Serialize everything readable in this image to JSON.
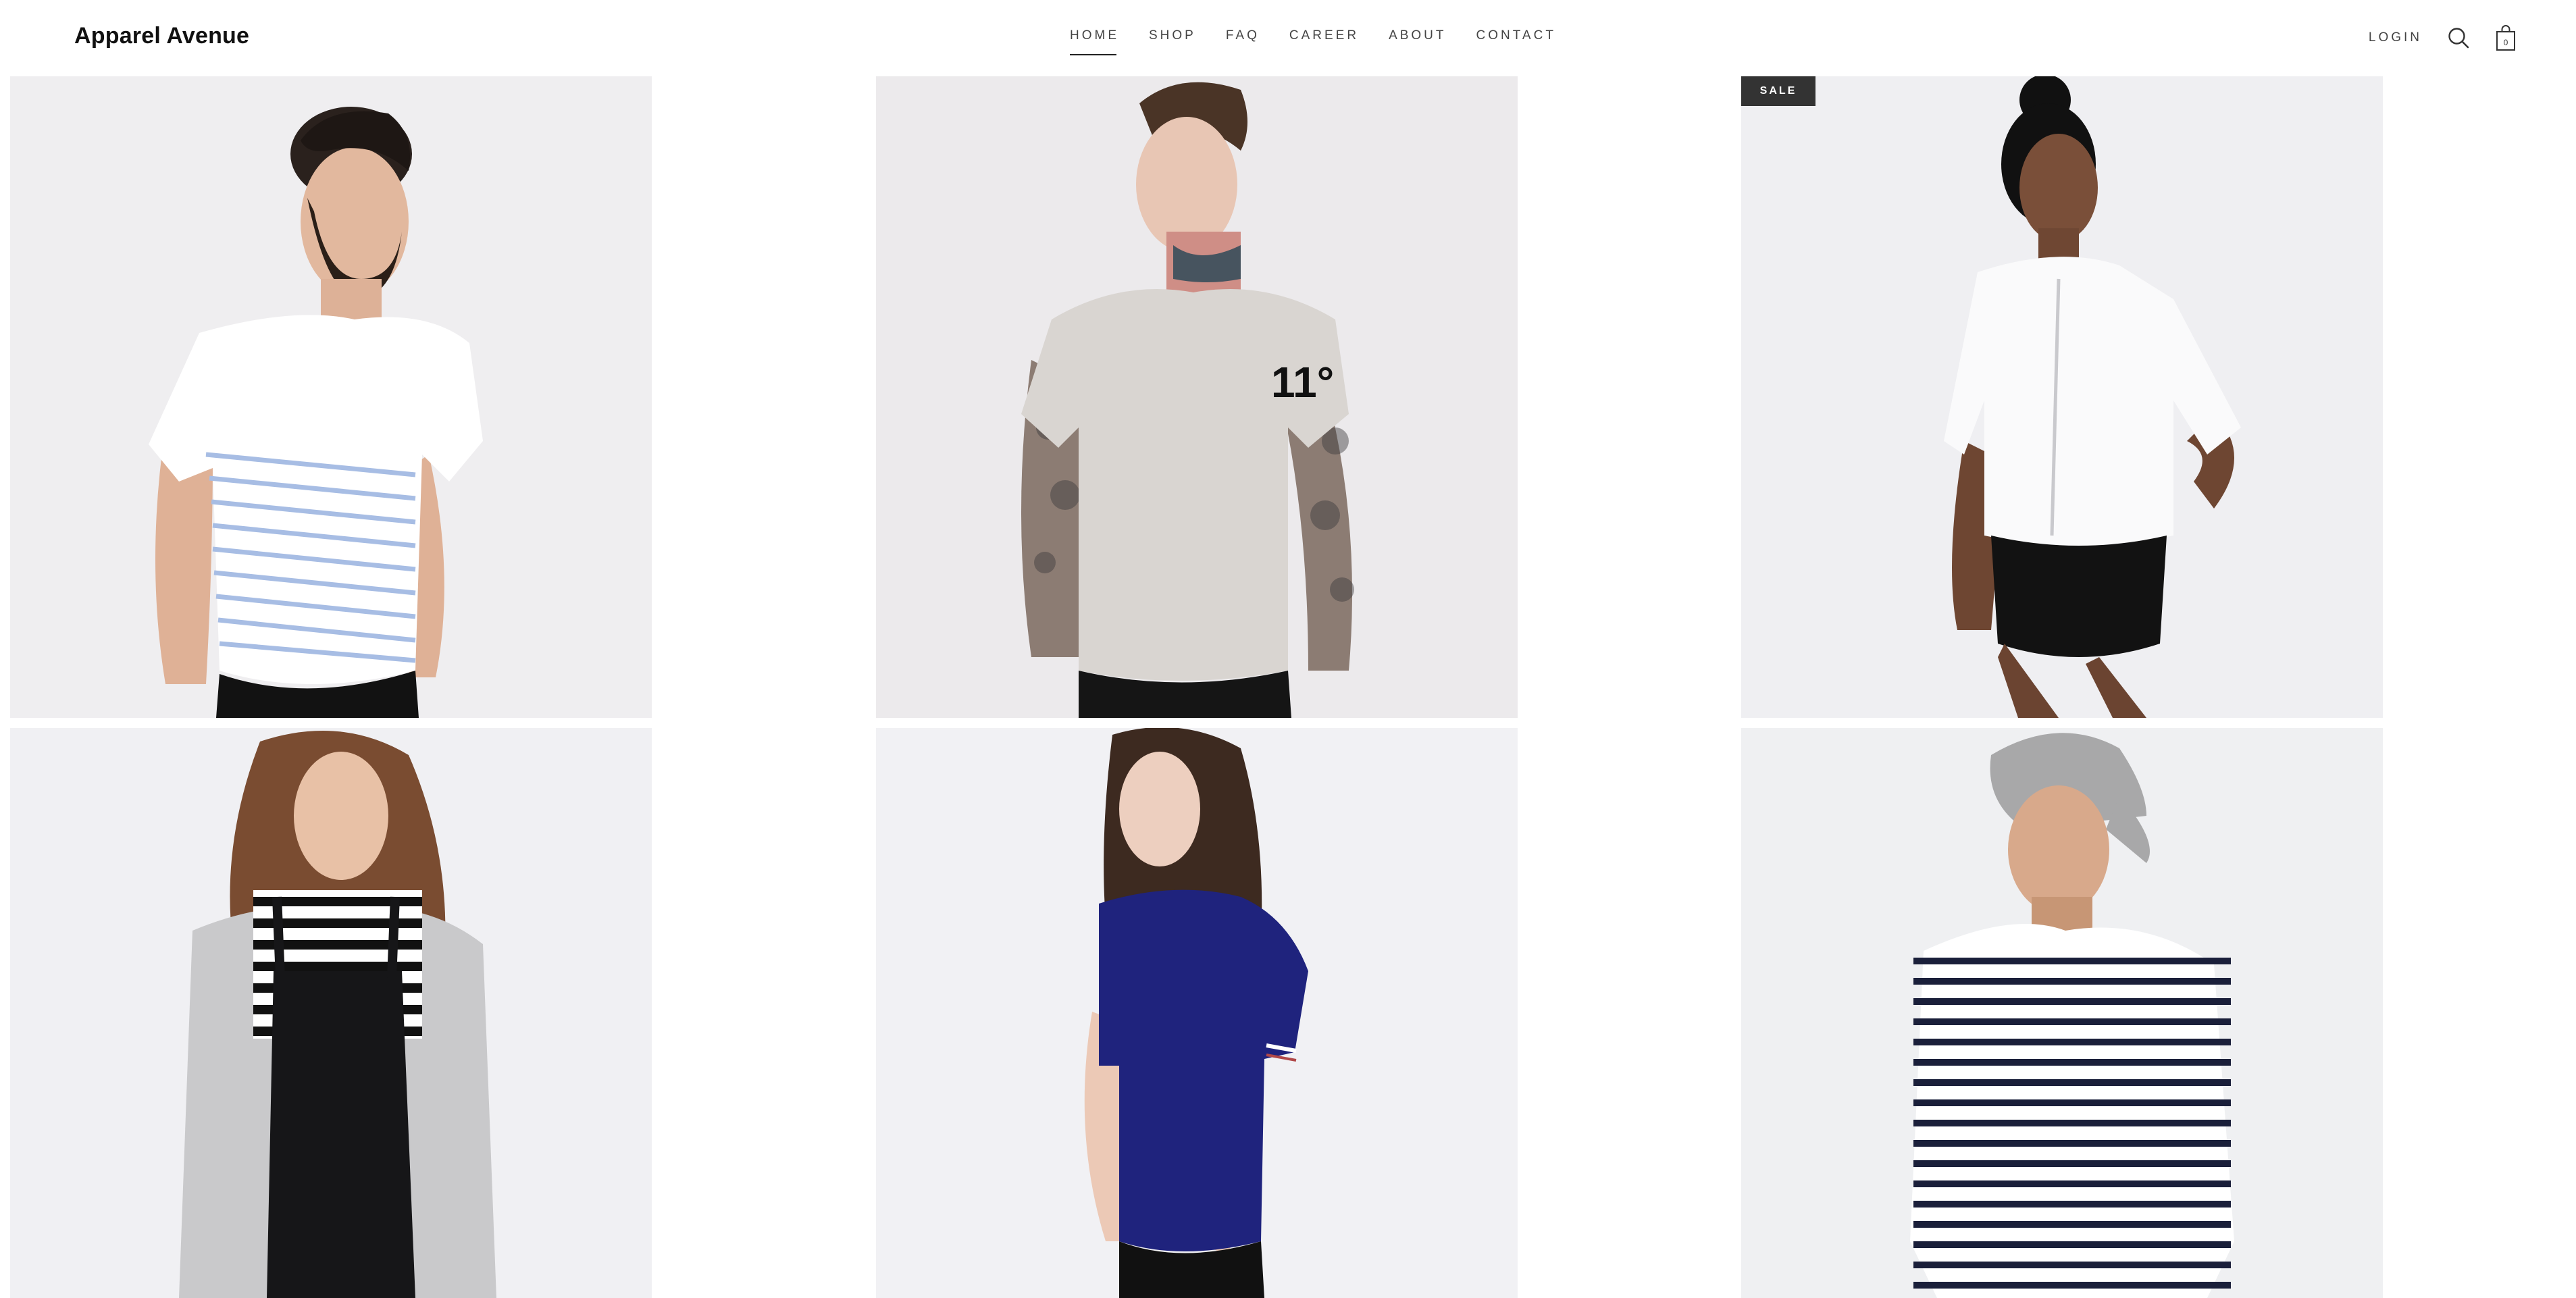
{
  "brand": {
    "name": "Apparel Avenue"
  },
  "nav": {
    "items": [
      {
        "label": "HOME",
        "active": true
      },
      {
        "label": "SHOP",
        "active": false
      },
      {
        "label": "FAQ",
        "active": false
      },
      {
        "label": "CAREER",
        "active": false
      },
      {
        "label": "ABOUT",
        "active": false
      },
      {
        "label": "CONTACT",
        "active": false
      }
    ]
  },
  "header_actions": {
    "login_label": "LOGIN",
    "search_icon": "search-icon",
    "cart_icon": "shopping-bag-icon",
    "cart_count": "0"
  },
  "products": [
    {
      "id": "white-striped-tee",
      "badge": null,
      "background": "#efeef0"
    },
    {
      "id": "grey-11-degrees-tee",
      "badge": null,
      "background": "#eceaec"
    },
    {
      "id": "white-zip-jacket",
      "badge": "SALE",
      "background": "#efeff2"
    },
    {
      "id": "grey-cardigan-dungarees",
      "badge": null,
      "background": "#f0f0f3"
    },
    {
      "id": "navy-ringer-tee",
      "badge": null,
      "background": "#f1f1f4"
    },
    {
      "id": "striped-long-sleeve-cap",
      "badge": null,
      "background": "#eff0f2"
    }
  ],
  "colors": {
    "text": "#222222",
    "nav_text": "#444444",
    "badge_bg": "#333333",
    "badge_text": "#ffffff"
  }
}
